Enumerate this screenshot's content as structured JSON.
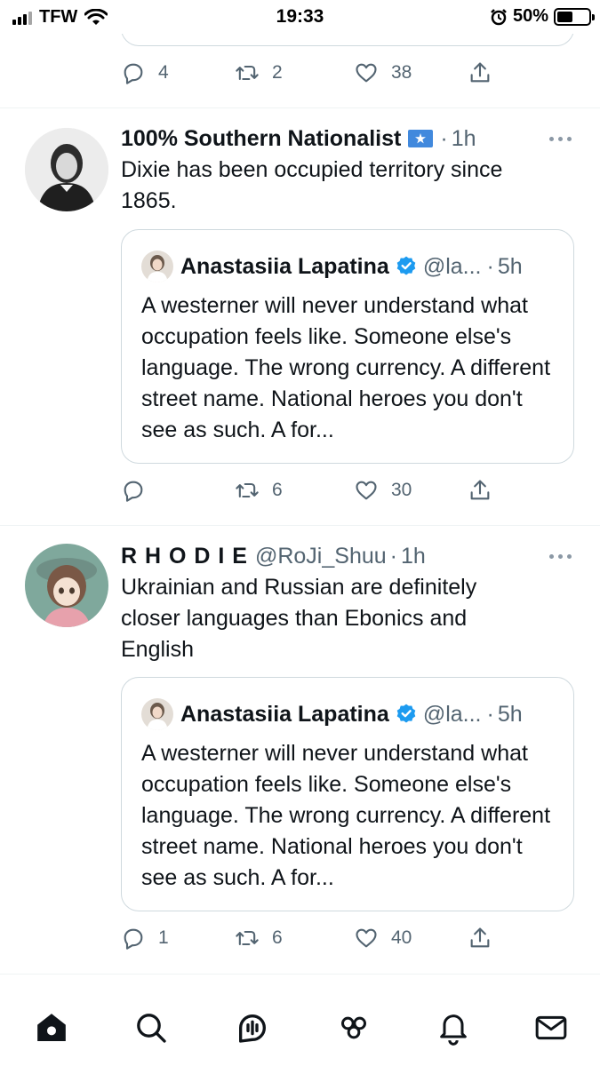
{
  "status_bar": {
    "carrier": "TFW",
    "time": "19:33",
    "battery_percent": "50%",
    "battery_level": 0.5
  },
  "prev_tweet": {
    "actions": {
      "replies": "4",
      "retweets": "2",
      "likes": "38"
    }
  },
  "tweets": [
    {
      "name": "100% Southern Nationalist",
      "handle": "",
      "dot": "·",
      "time": "1h",
      "text": "Dixie has been occupied territory since\n1865.",
      "quote": {
        "name": "Anastasiia Lapatina",
        "handle": "@la...",
        "dot": "·",
        "time": "5h",
        "text": "A westerner will never understand what occupation feels like. Someone else's language. The wrong currency. A different street name. National heroes you don't see as such. A for..."
      },
      "actions": {
        "replies": "",
        "retweets": "6",
        "likes": "30"
      }
    },
    {
      "name": "R H O D I E",
      "handle": "@RoJi_Shuu",
      "dot": "·",
      "time": "1h",
      "text": "Ukrainian and Russian are definitely\ncloser languages than Ebonics and\nEnglish",
      "quote": {
        "name": "Anastasiia Lapatina",
        "handle": "@la...",
        "dot": "·",
        "time": "5h",
        "text": "A westerner will never understand what occupation feels like. Someone else's language. The wrong currency. A different street name. National heroes you don't see as such. A for..."
      },
      "actions": {
        "replies": "1",
        "retweets": "6",
        "likes": "40"
      }
    }
  ],
  "icons": {
    "reply": "reply-icon",
    "retweet": "retweet-icon",
    "like": "heart-icon",
    "share": "share-icon",
    "tabs": [
      "home-icon",
      "search-icon",
      "spaces-icon",
      "communities-icon",
      "notifications-icon",
      "messages-icon"
    ]
  },
  "colors": {
    "text": "#0f1419",
    "secondary": "#536471",
    "verified": "#1d9bf0",
    "border": "#cfd9de"
  }
}
